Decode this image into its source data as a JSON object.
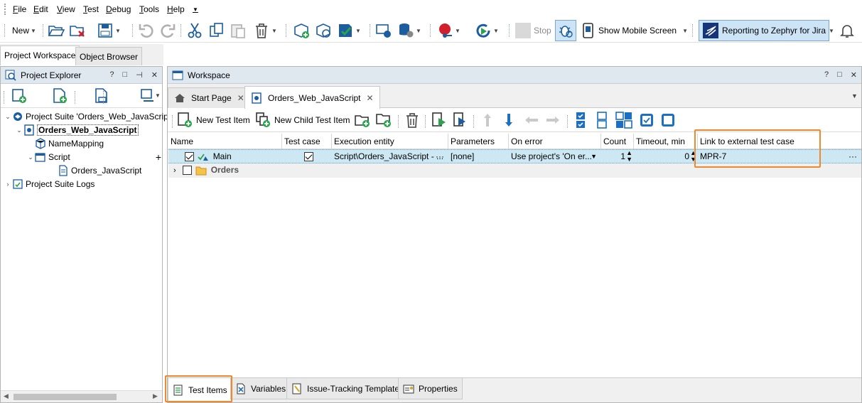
{
  "menu": [
    "File",
    "Edit",
    "View",
    "Test",
    "Debug",
    "Tools",
    "Help"
  ],
  "toolbar": {
    "new_label": "New",
    "stop_label": "Stop",
    "mobile_label": "Show Mobile Screen",
    "zephyr_label": "Reporting to Zephyr for Jira"
  },
  "left_tabs": [
    "Project Workspace",
    "Object Browser"
  ],
  "explorer": {
    "title": "Project Explorer",
    "head_buttons": [
      "?",
      "□",
      "⊣",
      "✕"
    ],
    "tree": [
      {
        "label": "Project Suite 'Orders_Web_JavaScript'",
        "bold": false
      },
      {
        "label": "Orders_Web_JavaScript",
        "bold": true
      },
      {
        "label": "NameMapping",
        "bold": false
      },
      {
        "label": "Script",
        "bold": false
      },
      {
        "label": "Orders_JavaScript",
        "bold": false
      },
      {
        "label": "Project Suite Logs",
        "bold": false
      }
    ]
  },
  "workspace": {
    "title": "Workspace",
    "head_buttons": [
      "?",
      "□",
      "✕"
    ],
    "tabs": [
      "Start Page",
      "Orders_Web_JavaScript"
    ],
    "actions": {
      "new_test_item": "New Test Item",
      "new_child_test_item": "New Child Test Item"
    },
    "columns": [
      "Name",
      "Test case",
      "Execution entity",
      "Parameters",
      "On error",
      "Count",
      "Timeout, min",
      "Link to external test case"
    ],
    "rows": [
      {
        "name": "Main",
        "test_case": true,
        "execution_entity": "Script\\Orders_JavaScript - ...",
        "parameters": "[none]",
        "on_error": "Use project's 'On er...",
        "count": "1",
        "timeout": "0",
        "link": "MPR-7"
      },
      {
        "name": "Orders"
      }
    ],
    "bottom_tabs": [
      "Test Items",
      "Variables",
      "Issue-Tracking Templates",
      "Properties"
    ]
  },
  "colors": {
    "accent_orange": "#f0892c",
    "selection": "#cde8f2",
    "pane_header": "#dfe7ef"
  }
}
